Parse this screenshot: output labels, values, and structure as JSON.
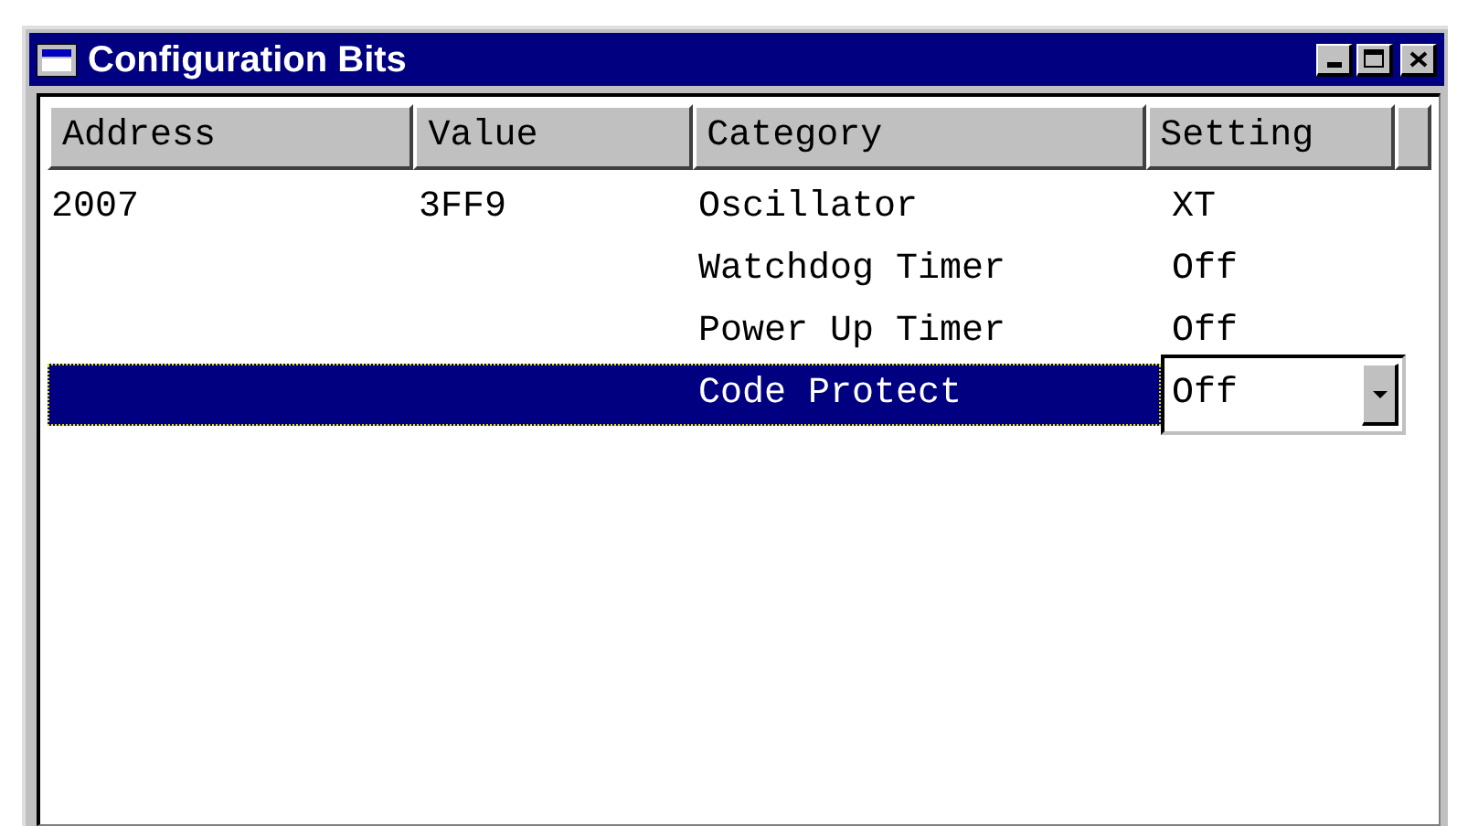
{
  "window": {
    "title": "Configuration Bits"
  },
  "table": {
    "columns": [
      "Address",
      "Value",
      "Category",
      "Setting"
    ],
    "rows": [
      {
        "address": "2007",
        "value": "3FF9",
        "category": "Oscillator",
        "setting": {
          "kind": "text",
          "value": "XT"
        },
        "selected": false
      },
      {
        "category": "Watchdog Timer",
        "setting": {
          "kind": "text",
          "value": "Off"
        },
        "selected": false
      },
      {
        "category": "Power Up Timer",
        "setting": {
          "kind": "text",
          "value": "Off"
        },
        "selected": false
      },
      {
        "category": "Code Protect",
        "setting": {
          "kind": "dropdown",
          "value": "Off"
        },
        "selected": true
      }
    ]
  }
}
